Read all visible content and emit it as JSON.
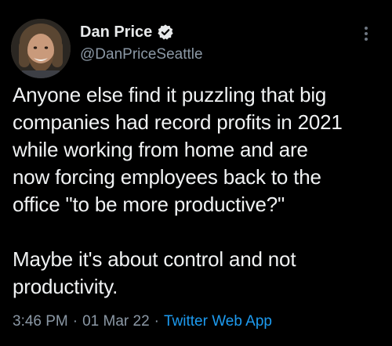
{
  "author": {
    "display_name": "Dan Price",
    "handle": "@DanPriceSeattle",
    "verified": true
  },
  "tweet": {
    "paragraphs": [
      "Anyone else find it puzzling that big\ncompanies had record profits in 2021\nwhile working from home and are\nnow forcing employees back to the\noffice \"to be more productive?\"",
      "Maybe it's about control and not\nproductivity."
    ],
    "time": "3:46 PM",
    "date": "01 Mar 22",
    "source": "Twitter Web App",
    "separator": "·"
  },
  "icons": {
    "verified": "verified-badge-icon",
    "more": "more-vertical-icon"
  },
  "colors": {
    "background": "#000000",
    "text": "#e7e9ea",
    "secondary": "#8b98a5",
    "accent": "#1d9bf0"
  }
}
